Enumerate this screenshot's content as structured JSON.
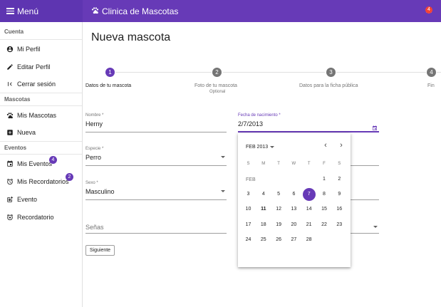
{
  "topbar": {
    "menu_label": "Menú",
    "app_title": "Clinica de Mascotas",
    "notification_count": "4"
  },
  "sidebar": {
    "sections": [
      {
        "title": "Cuenta",
        "items": [
          {
            "label": "Mi Perfil",
            "icon": "account-circle-icon"
          },
          {
            "label": "Editar Perfil",
            "icon": "edit-pencil-icon"
          },
          {
            "label": "Cerrar sesión",
            "icon": "logout-icon"
          }
        ]
      },
      {
        "title": "Mascotas",
        "items": [
          {
            "label": "Mis Mascotas",
            "icon": "paw-icon"
          },
          {
            "label": "Nueva",
            "icon": "add-box-icon"
          }
        ]
      },
      {
        "title": "Eventos",
        "items": [
          {
            "label": "Mis Eventos",
            "icon": "event-icon",
            "badge": "4"
          },
          {
            "label": "Mis Recordatorios",
            "icon": "alarm-icon",
            "badge": "2"
          },
          {
            "label": "Evento",
            "icon": "post-add-icon"
          },
          {
            "label": "Recordatorio",
            "icon": "alarm-add-icon"
          }
        ]
      }
    ]
  },
  "page": {
    "title": "Nueva mascota"
  },
  "stepper": {
    "steps": [
      {
        "number": "1",
        "label": "Datos de tu mascota",
        "active": true
      },
      {
        "number": "2",
        "label": "Foto de tu mascota",
        "optional": "Optional"
      },
      {
        "number": "3",
        "label": "Datos para la ficha pública"
      },
      {
        "number": "4",
        "label": "Fin"
      }
    ]
  },
  "form": {
    "nombre": {
      "label": "Nombre *",
      "value": "Herny"
    },
    "fecha": {
      "label": "Fecha de nacimiento *",
      "value": "2/7/2013"
    },
    "especie": {
      "label": "Especie *",
      "value": "Perro"
    },
    "sexo": {
      "label": "Sexo *",
      "value": "Masculino"
    },
    "senas": {
      "placeholder": "Señas"
    },
    "submit_label": "Siguiente"
  },
  "calendar": {
    "period_label": "FEB 2013",
    "prev_icon": "chevron-left-icon",
    "next_icon": "chevron-right-icon",
    "weekdays": [
      "S",
      "M",
      "T",
      "W",
      "T",
      "F",
      "S"
    ],
    "month_label": "FEB",
    "days": [
      "1",
      "2",
      "3",
      "4",
      "5",
      "6",
      "7",
      "8",
      "9",
      "10",
      "11",
      "12",
      "13",
      "14",
      "15",
      "16",
      "17",
      "18",
      "19",
      "20",
      "21",
      "22",
      "23",
      "24",
      "25",
      "26",
      "27",
      "28"
    ],
    "selected_day": "7",
    "today_day": "11",
    "first_weekday_index": 5,
    "colors": {
      "accent": "#673ab7"
    }
  },
  "colors": {
    "appbar": "#673ab7",
    "appbar_dark": "#5e35b1",
    "badge_red": "#f44336"
  }
}
